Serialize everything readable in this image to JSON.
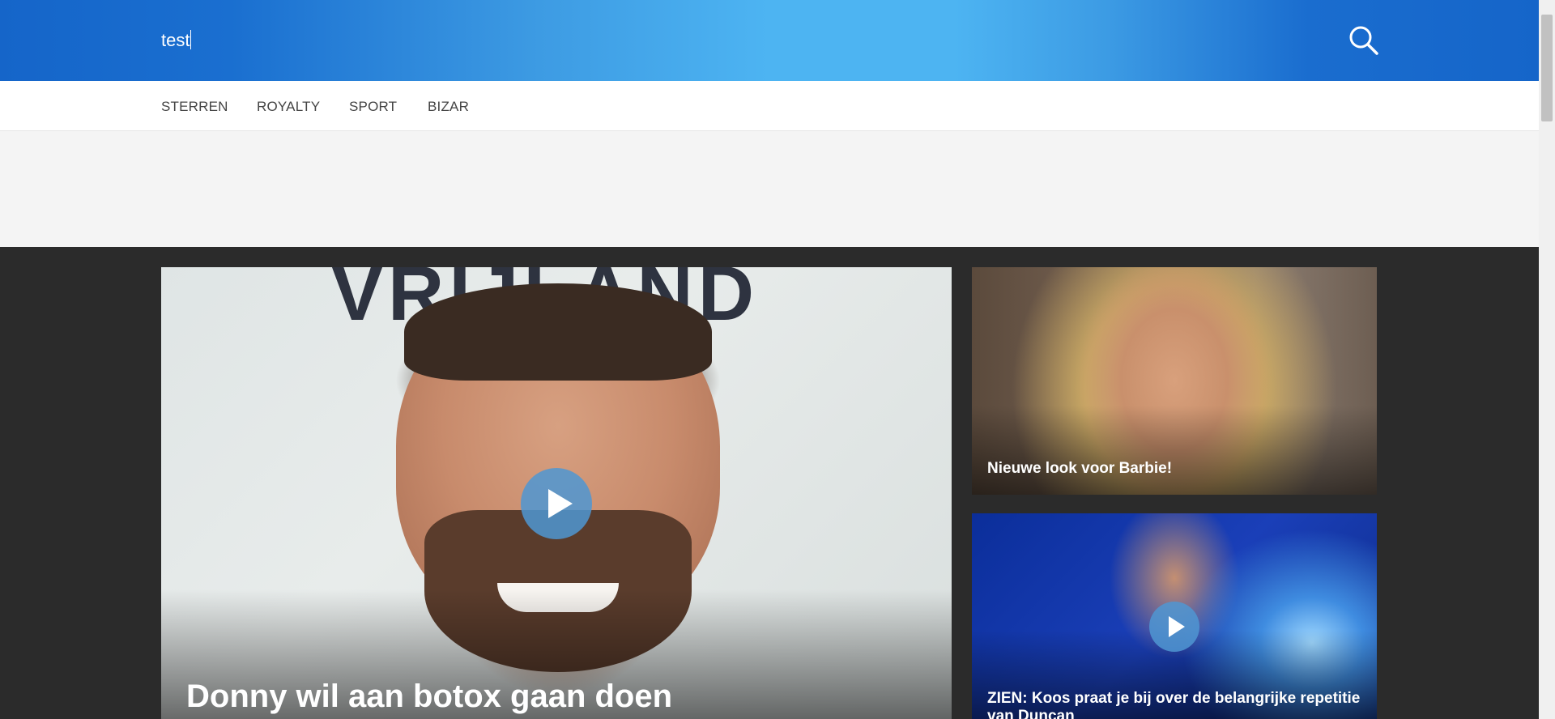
{
  "header": {
    "search_value": "test",
    "search_icon": "search-icon"
  },
  "nav": {
    "items": [
      {
        "label": "STERREN"
      },
      {
        "label": "ROYALTY"
      },
      {
        "label": "SPORT"
      },
      {
        "label": "BIZAR"
      }
    ]
  },
  "featured": {
    "main": {
      "title": "Donny wil aan botox gaan doen",
      "has_video": true,
      "image_text": "VRIJLAND"
    },
    "side": [
      {
        "title": "Nieuwe look voor Barbie!",
        "has_video": false
      },
      {
        "title": "ZIEN: Koos praat je bij over de belangrijke repetitie van Duncan",
        "has_video": true
      }
    ]
  },
  "colors": {
    "header_gradient_edge": "#1565c9",
    "header_gradient_center": "#4db4f2",
    "nav_bg": "#ffffff",
    "content_bg": "#2b2b2b",
    "play_button": "#4f96d2"
  }
}
